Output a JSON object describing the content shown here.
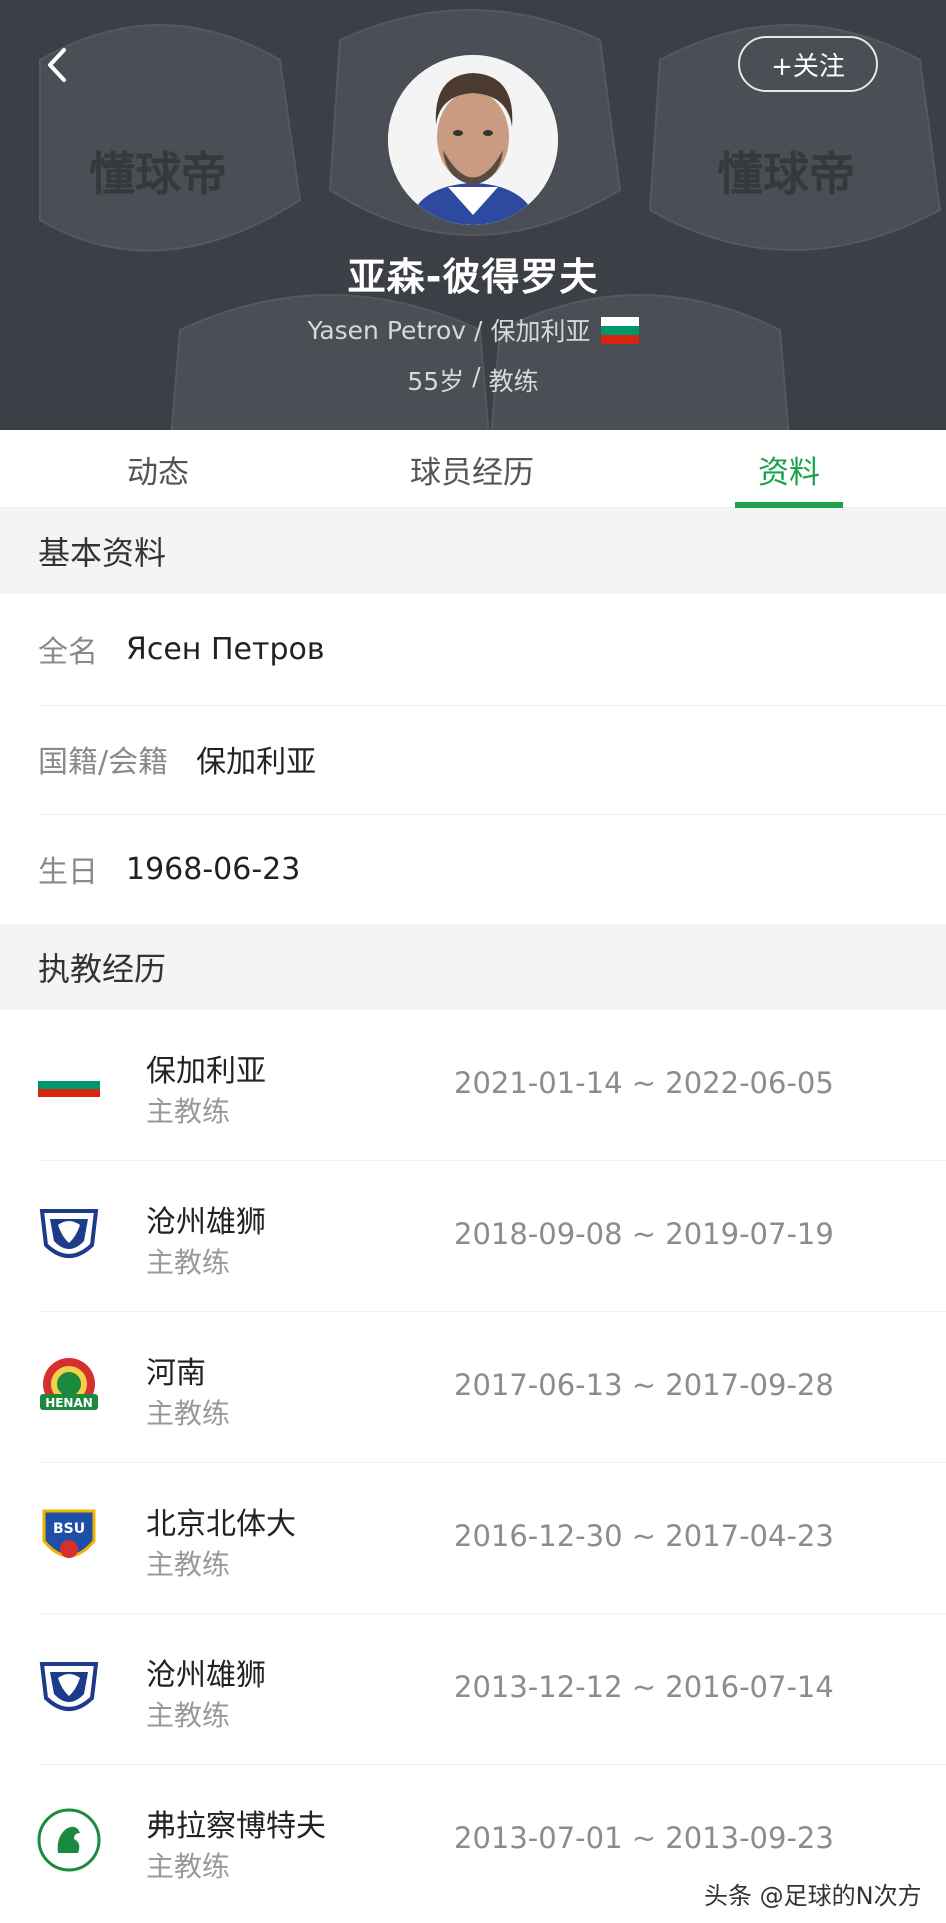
{
  "header": {
    "follow_label": "+关注",
    "name_cn": "亚森-彼得罗夫",
    "name_en": "Yasen Petrov",
    "separator": "/",
    "nationality": "保加利亚",
    "age": "55岁",
    "position": "教练",
    "bg_watermark": "懂球帝",
    "accent_color": "#1aa34a"
  },
  "tabs": [
    {
      "label": "动态",
      "active": false
    },
    {
      "label": "球员经历",
      "active": false
    },
    {
      "label": "资料",
      "active": true
    }
  ],
  "basic_info": {
    "title": "基本资料",
    "fields": [
      {
        "label": "全名",
        "value": "Ясен Петров"
      },
      {
        "label": "国籍/会籍",
        "value": "保加利亚"
      },
      {
        "label": "生日",
        "value": "1968-06-23"
      }
    ]
  },
  "coaching": {
    "title": "执教经历",
    "items": [
      {
        "team": "保加利亚",
        "role": "主教练",
        "period": "2021-01-14 ~ 2022-06-05",
        "logo": "bulgaria-flag-icon"
      },
      {
        "team": "沧州雄狮",
        "role": "主教练",
        "period": "2018-09-08 ~ 2019-07-19",
        "logo": "cangzhou-lions-crest-icon"
      },
      {
        "team": "河南",
        "role": "主教练",
        "period": "2017-06-13 ~ 2017-09-28",
        "logo": "henan-crest-icon",
        "logo_text": "HENAN"
      },
      {
        "team": "北京北体大",
        "role": "主教练",
        "period": "2016-12-30 ~ 2017-04-23",
        "logo": "bsu-crest-icon",
        "logo_text": "BSU"
      },
      {
        "team": "沧州雄狮",
        "role": "主教练",
        "period": "2013-12-12 ~ 2016-07-14",
        "logo": "cangzhou-lions-crest-icon"
      },
      {
        "team": "弗拉察博特夫",
        "role": "主教练",
        "period": "2013-07-01 ~ 2013-09-23",
        "logo": "botev-vratsa-crest-icon"
      }
    ]
  },
  "watermark": "头条 @足球的N次方"
}
